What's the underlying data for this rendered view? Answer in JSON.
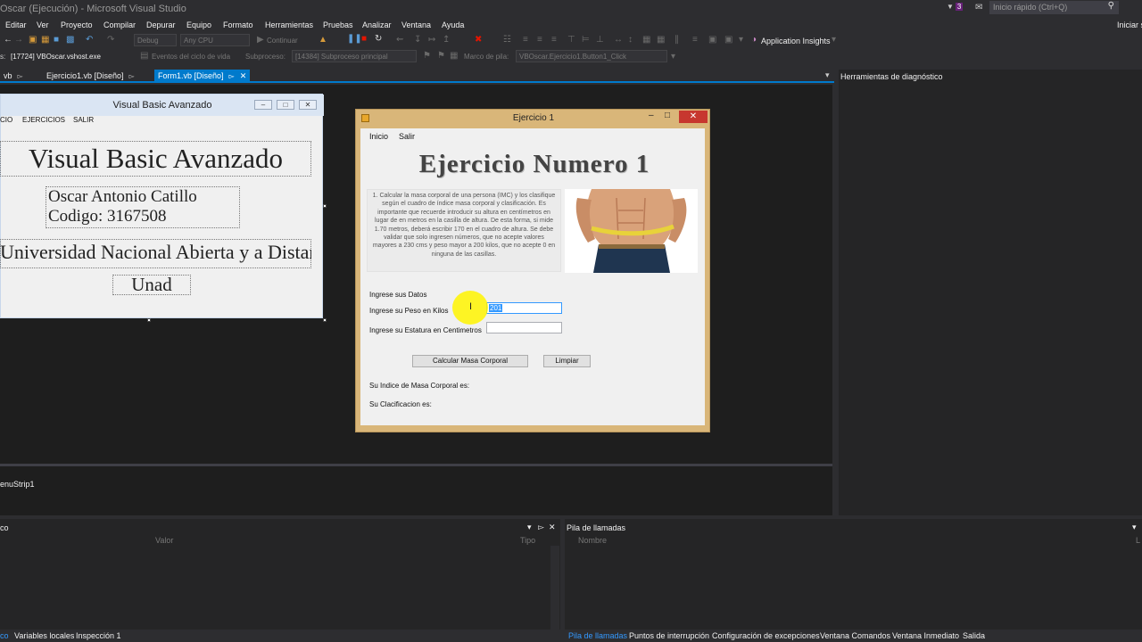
{
  "window_title": "Oscar (Ejecución) - Microsoft Visual Studio",
  "notifications": {
    "count": "3"
  },
  "quick_launch": {
    "placeholder": "Inicio rápido (Ctrl+Q)"
  },
  "signin": "Iniciar s",
  "menu": [
    "Editar",
    "Ver",
    "Proyecto",
    "Compilar",
    "Depurar",
    "Equipo",
    "Formato",
    "Herramientas",
    "Pruebas",
    "Analizar",
    "Ventana",
    "Ayuda"
  ],
  "toolbar": {
    "config": "Debug",
    "platform": "Any CPU",
    "continue": "Continuar",
    "app_insights": "Application Insights"
  },
  "debug_bar": {
    "process_prefix": "s:",
    "process": "[17724] VBOscar.vshost.exe",
    "lifecycle": "Eventos del ciclo de vida",
    "thread_label": "Subproceso:",
    "thread": "[14384] Subproceso principal",
    "stack_label": "Marco de pila:",
    "stack": "VBOscar.Ejercicio1.Button1_Click"
  },
  "doc_tabs": [
    {
      "label": "vb",
      "active": false
    },
    {
      "label": "Ejercicio1.vb [Diseño]",
      "active": false
    },
    {
      "label": "Form1.vb [Diseño]",
      "active": true
    }
  ],
  "vb_form": {
    "title": "Visual Basic Avanzado",
    "menu": [
      "CIO",
      "EJERCICIOS",
      "SALIR"
    ],
    "heading": "Visual Basic Avanzado",
    "author_line1": "Oscar Antonio Catillo",
    "author_line2": "Codigo: 3167508",
    "university": "Universidad Nacional Abierta y a Distancia",
    "acronym": "Unad"
  },
  "component_tray": {
    "item": "enuStrip1"
  },
  "ejercicio_window": {
    "title": "Ejercicio 1",
    "menu": [
      "Inicio",
      "Salir"
    ],
    "heading": "Ejercicio Numero 1",
    "instructions": "1. Calcular la masa corporal de una persona (IMC) y los clasifique según el cuadro de índice masa corporal y clasificación. Es importante que recuerde introducir su altura en centímetros en lugar de en metros en la casilla de altura. De esta forma, si mide 1.70 metros, deberá escribir 170 en el cuadro de altura. Se debe validar que solo ingresen números, que no acepte valores mayores a 230 cms y peso mayor a 200 kilos, que no acepte 0 en ninguna de las casillas.",
    "label_datos": "Ingrese sus Datos",
    "label_peso": "Ingrese su Peso en Kilos",
    "peso_value": "201",
    "label_estatura": "Ingrese su Estatura en Centimetros",
    "estatura_value": "",
    "btn_calcular": "Calcular Masa Corporal",
    "btn_limpiar": "Limpiar",
    "label_indice": "Su Indice de Masa Corporal es:",
    "label_clasificacion": "Su Clacificacion es:"
  },
  "diag_panel": {
    "title": "Herramientas de diagnóstico"
  },
  "bottom_left": {
    "title": "co",
    "columns": [
      "Valor",
      "Tipo"
    ],
    "tabs": [
      {
        "label": "co",
        "active": true
      },
      {
        "label": "Variables locales",
        "active": false
      },
      {
        "label": "Inspección 1",
        "active": false
      }
    ]
  },
  "bottom_right": {
    "title": "Pila de llamadas",
    "columns": [
      "Nombre",
      "L"
    ],
    "tabs": [
      {
        "label": "Pila de llamadas",
        "active": true
      },
      {
        "label": "Puntos de interrupción",
        "active": false
      },
      {
        "label": "Configuración de excepciones",
        "active": false
      },
      {
        "label": "Ventana Comandos",
        "active": false
      },
      {
        "label": "Ventana Inmediato",
        "active": false
      },
      {
        "label": "Salida",
        "active": false
      }
    ]
  },
  "colors": {
    "accent": "#007acc",
    "chrome": "#2d2d30",
    "editor_bg": "#1e1e1e",
    "panel_bg": "#252526",
    "form_border": "#d9b679"
  }
}
